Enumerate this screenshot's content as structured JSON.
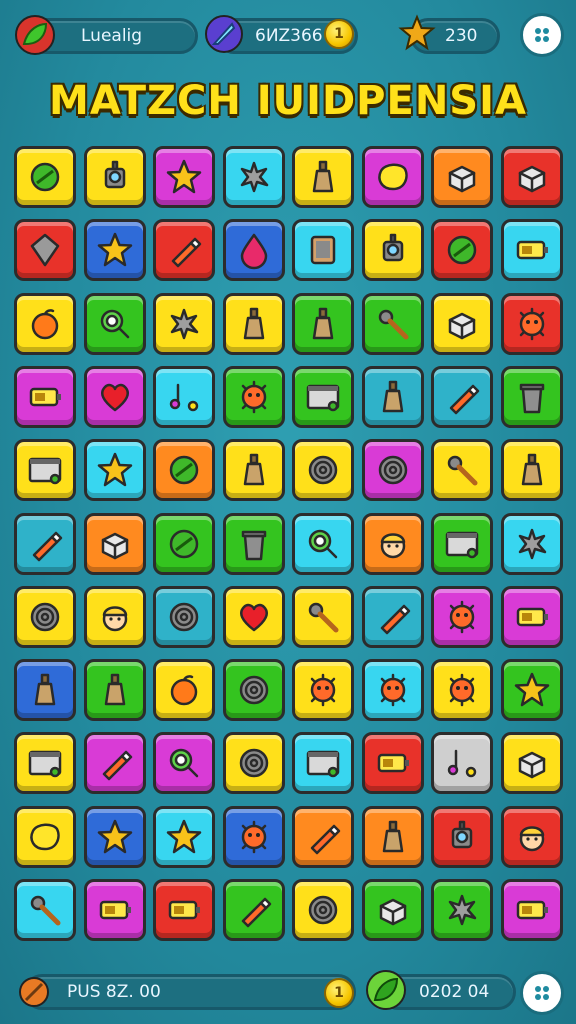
{
  "hud_top": {
    "player_label": "Luealig",
    "gem_value": "6ИZ366",
    "coin_symbol": "1",
    "star_value": "230"
  },
  "title": "MATZCH IUIDPENSIA",
  "hud_bottom": {
    "left_value": "PUЅ 8Z. 00",
    "coin_symbol": "1",
    "right_value": "0202 04"
  },
  "colors": {
    "yellow": "#ffe01a",
    "orange": "#ff8a1f",
    "red": "#e8322a",
    "magenta": "#d93bd6",
    "cyan": "#38d6f0",
    "green": "#34c41f",
    "blue": "#2f6bd8",
    "teal": "#2fb2c9",
    "lime": "#7cd321",
    "grey": "#cfcfcf"
  },
  "board": {
    "rows": [
      [
        [
          "yellow",
          "leaf-icon"
        ],
        [
          "yellow",
          "robot-icon"
        ],
        [
          "magenta",
          "star-icon"
        ],
        [
          "cyan",
          "splat-icon"
        ],
        [
          "yellow",
          "bottle-icon"
        ],
        [
          "magenta",
          "blob-icon"
        ],
        [
          "orange",
          "box-icon"
        ],
        [
          "red",
          "box-icon"
        ]
      ],
      [
        [
          "red",
          "gem-icon"
        ],
        [
          "blue",
          "star-icon"
        ],
        [
          "red",
          "crayon-icon"
        ],
        [
          "blue",
          "drop-icon"
        ],
        [
          "cyan",
          "tablet-icon"
        ],
        [
          "yellow",
          "robot-icon"
        ],
        [
          "red",
          "leaf-icon"
        ],
        [
          "cyan",
          "battery-icon"
        ]
      ],
      [
        [
          "yellow",
          "apple-icon"
        ],
        [
          "green",
          "magnifier-icon"
        ],
        [
          "yellow",
          "splat-icon"
        ],
        [
          "yellow",
          "bottle-icon"
        ],
        [
          "green",
          "bottle-icon"
        ],
        [
          "green",
          "match-icon"
        ],
        [
          "yellow",
          "box-icon"
        ],
        [
          "red",
          "virus-icon"
        ]
      ],
      [
        [
          "magenta",
          "battery-icon"
        ],
        [
          "magenta",
          "heart-icon"
        ],
        [
          "cyan",
          "note-icon"
        ],
        [
          "green",
          "virus-icon"
        ],
        [
          "green",
          "window-icon"
        ],
        [
          "teal",
          "bottle-icon"
        ],
        [
          "teal",
          "crayon-icon"
        ],
        [
          "green",
          "bin-icon"
        ]
      ],
      [
        [
          "yellow",
          "window-icon"
        ],
        [
          "cyan",
          "star-icon"
        ],
        [
          "orange",
          "leaf-icon"
        ],
        [
          "yellow",
          "bottle-icon"
        ],
        [
          "yellow",
          "spiral-icon"
        ],
        [
          "magenta",
          "spiral-icon"
        ],
        [
          "yellow",
          "match-icon"
        ],
        [
          "yellow",
          "bottle-icon"
        ]
      ],
      [
        [
          "teal",
          "crayon-icon"
        ],
        [
          "orange",
          "box-icon"
        ],
        [
          "green",
          "leaf-icon"
        ],
        [
          "green",
          "bin-icon"
        ],
        [
          "cyan",
          "magnifier-icon"
        ],
        [
          "orange",
          "face-icon"
        ],
        [
          "green",
          "window-icon"
        ],
        [
          "cyan",
          "splat-icon"
        ]
      ],
      [
        [
          "yellow",
          "spiral-icon"
        ],
        [
          "yellow",
          "face-icon"
        ],
        [
          "teal",
          "spiral-icon"
        ],
        [
          "yellow",
          "heart-icon"
        ],
        [
          "yellow",
          "match-icon"
        ],
        [
          "teal",
          "crayon-icon"
        ],
        [
          "magenta",
          "virus-icon"
        ],
        [
          "magenta",
          "battery-icon"
        ]
      ],
      [
        [
          "blue",
          "bottle-icon"
        ],
        [
          "green",
          "bottle-icon"
        ],
        [
          "yellow",
          "apple-icon"
        ],
        [
          "green",
          "spiral-icon"
        ],
        [
          "yellow",
          "virus-icon"
        ],
        [
          "cyan",
          "virus-icon"
        ],
        [
          "yellow",
          "virus-icon"
        ],
        [
          "green",
          "star-icon"
        ]
      ],
      [
        [
          "yellow",
          "window-icon"
        ],
        [
          "magenta",
          "crayon-icon"
        ],
        [
          "magenta",
          "magnifier-icon"
        ],
        [
          "yellow",
          "spiral-icon"
        ],
        [
          "cyan",
          "window-icon"
        ],
        [
          "red",
          "battery-icon"
        ],
        [
          "grey",
          "note-icon"
        ],
        [
          "yellow",
          "box-icon"
        ]
      ],
      [
        [
          "yellow",
          "blob-icon"
        ],
        [
          "blue",
          "star-icon"
        ],
        [
          "cyan",
          "star-icon"
        ],
        [
          "blue",
          "virus-icon"
        ],
        [
          "orange",
          "crayon-icon"
        ],
        [
          "orange",
          "bottle-icon"
        ],
        [
          "red",
          "robot-icon"
        ],
        [
          "red",
          "face-icon"
        ]
      ],
      [
        [
          "cyan",
          "match-icon"
        ],
        [
          "magenta",
          "battery-icon"
        ],
        [
          "red",
          "battery-icon"
        ],
        [
          "green",
          "crayon-icon"
        ],
        [
          "yellow",
          "spiral-icon"
        ],
        [
          "green",
          "box-icon"
        ],
        [
          "green",
          "splat-icon"
        ],
        [
          "magenta",
          "battery-icon"
        ]
      ]
    ]
  }
}
